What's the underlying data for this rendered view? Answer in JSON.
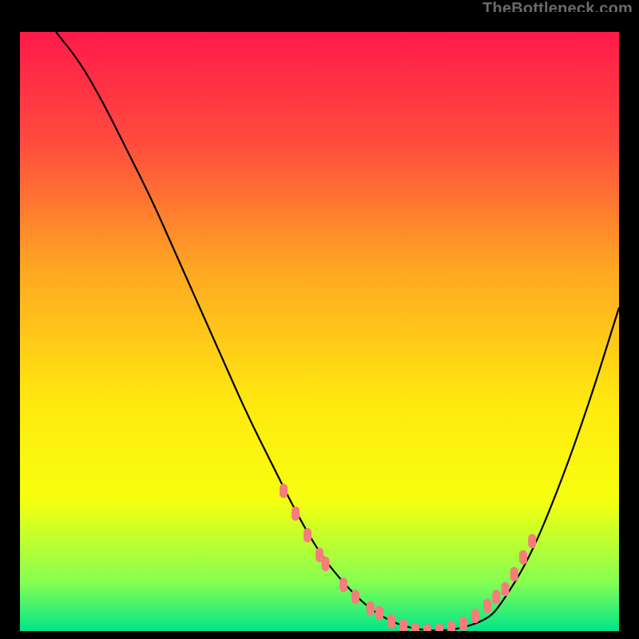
{
  "watermark": "TheBottleneck.com",
  "chart_data": {
    "type": "line",
    "title": "",
    "xlabel": "",
    "ylabel": "",
    "xlim": [
      0,
      100
    ],
    "ylim": [
      0,
      100
    ],
    "grid": false,
    "legend": false,
    "background_gradient": [
      "#ff1a4b",
      "#ff5239",
      "#ffa822",
      "#ffe90f",
      "#f7ff0e",
      "#84ff52",
      "#00e58a"
    ],
    "series": [
      {
        "name": "curve",
        "x": [
          6,
          10,
          14,
          18,
          22,
          26,
          30,
          34,
          38,
          42,
          46,
          50,
          54,
          58,
          62,
          66,
          70,
          74,
          78,
          80,
          85,
          90,
          95,
          100
        ],
        "y": [
          100,
          95,
          88,
          80,
          72,
          63,
          54,
          45,
          36,
          28,
          20,
          13,
          8,
          4,
          1.5,
          0.3,
          0,
          0.5,
          2,
          4,
          12,
          24,
          38,
          54
        ],
        "color": "#000000"
      }
    ],
    "markers": {
      "name": "highlighted-points",
      "color": "#f77c7c",
      "shape": "rounded-bar",
      "x": [
        44,
        46,
        48,
        50,
        51,
        54,
        56,
        58.5,
        60,
        62,
        64,
        66,
        68,
        70,
        72,
        74,
        76,
        78,
        79.5,
        81,
        82.5,
        84,
        85.5
      ],
      "y": [
        23.4,
        19.6,
        16.0,
        12.7,
        11.2,
        7.7,
        5.7,
        3.8,
        3.0,
        1.6,
        0.8,
        0.2,
        0.0,
        0.1,
        0.5,
        1.2,
        2.5,
        4.2,
        5.7,
        7.0,
        9.5,
        12.3,
        15.0
      ]
    }
  }
}
